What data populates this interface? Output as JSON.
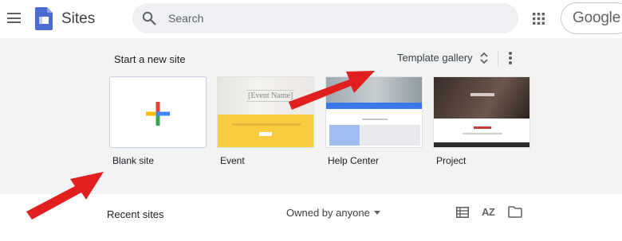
{
  "header": {
    "app_title": "Sites",
    "search": {
      "placeholder": "Search",
      "value": ""
    },
    "account_label": "Google"
  },
  "start_section": {
    "title": "Start a new site",
    "gallery_label": "Template gallery",
    "templates": [
      {
        "label": "Blank site"
      },
      {
        "label": "Event",
        "thumb_text": "[Event Name]"
      },
      {
        "label": "Help Center"
      },
      {
        "label": "Project"
      }
    ]
  },
  "recent_section": {
    "title": "Recent sites",
    "owner_filter": "Owned by anyone",
    "sort_icon_text": "AZ"
  },
  "colors": {
    "arrow": "#e21f1f",
    "section_bg": "#f1f3f4",
    "search_bg": "#eef0f4",
    "brand_blue": "#4d6bd5",
    "plus_blue": "#4285f4",
    "plus_red": "#ea4335",
    "plus_yellow": "#fbbc05",
    "plus_green": "#34a853"
  },
  "icons": [
    "menu-icon",
    "sites-logo-icon",
    "search-icon",
    "apps-icon",
    "unfold-icon",
    "more-vert-icon",
    "plus-icon",
    "caret-down-icon",
    "list-view-icon",
    "sort-az-icon",
    "folder-icon"
  ]
}
